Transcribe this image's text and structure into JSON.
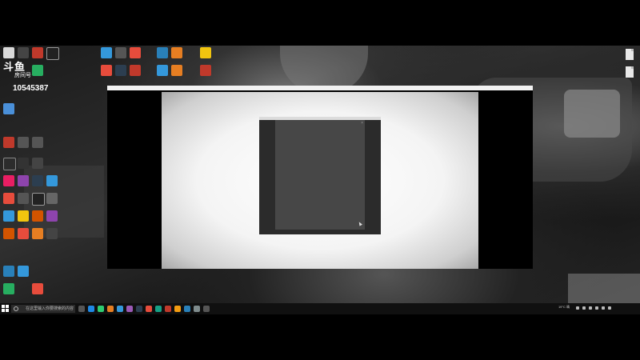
{
  "stream_overlay": {
    "logo": "斗鱼",
    "room_label": "房间号",
    "room_number": "10545387"
  },
  "app_window": {
    "title": "",
    "dialog_close": "×"
  },
  "taskbar": {
    "search_placeholder": "在这里输入你要搜索的内容",
    "weather": "19°C 晴",
    "time": "",
    "date": ""
  },
  "colors": {
    "desktop_bg": "#1e1e1e",
    "taskbar_bg": "#101010",
    "dialog_bg": "#2b2b2b",
    "dialog_panel": "#474747",
    "app_content": "#f4f4f4"
  }
}
